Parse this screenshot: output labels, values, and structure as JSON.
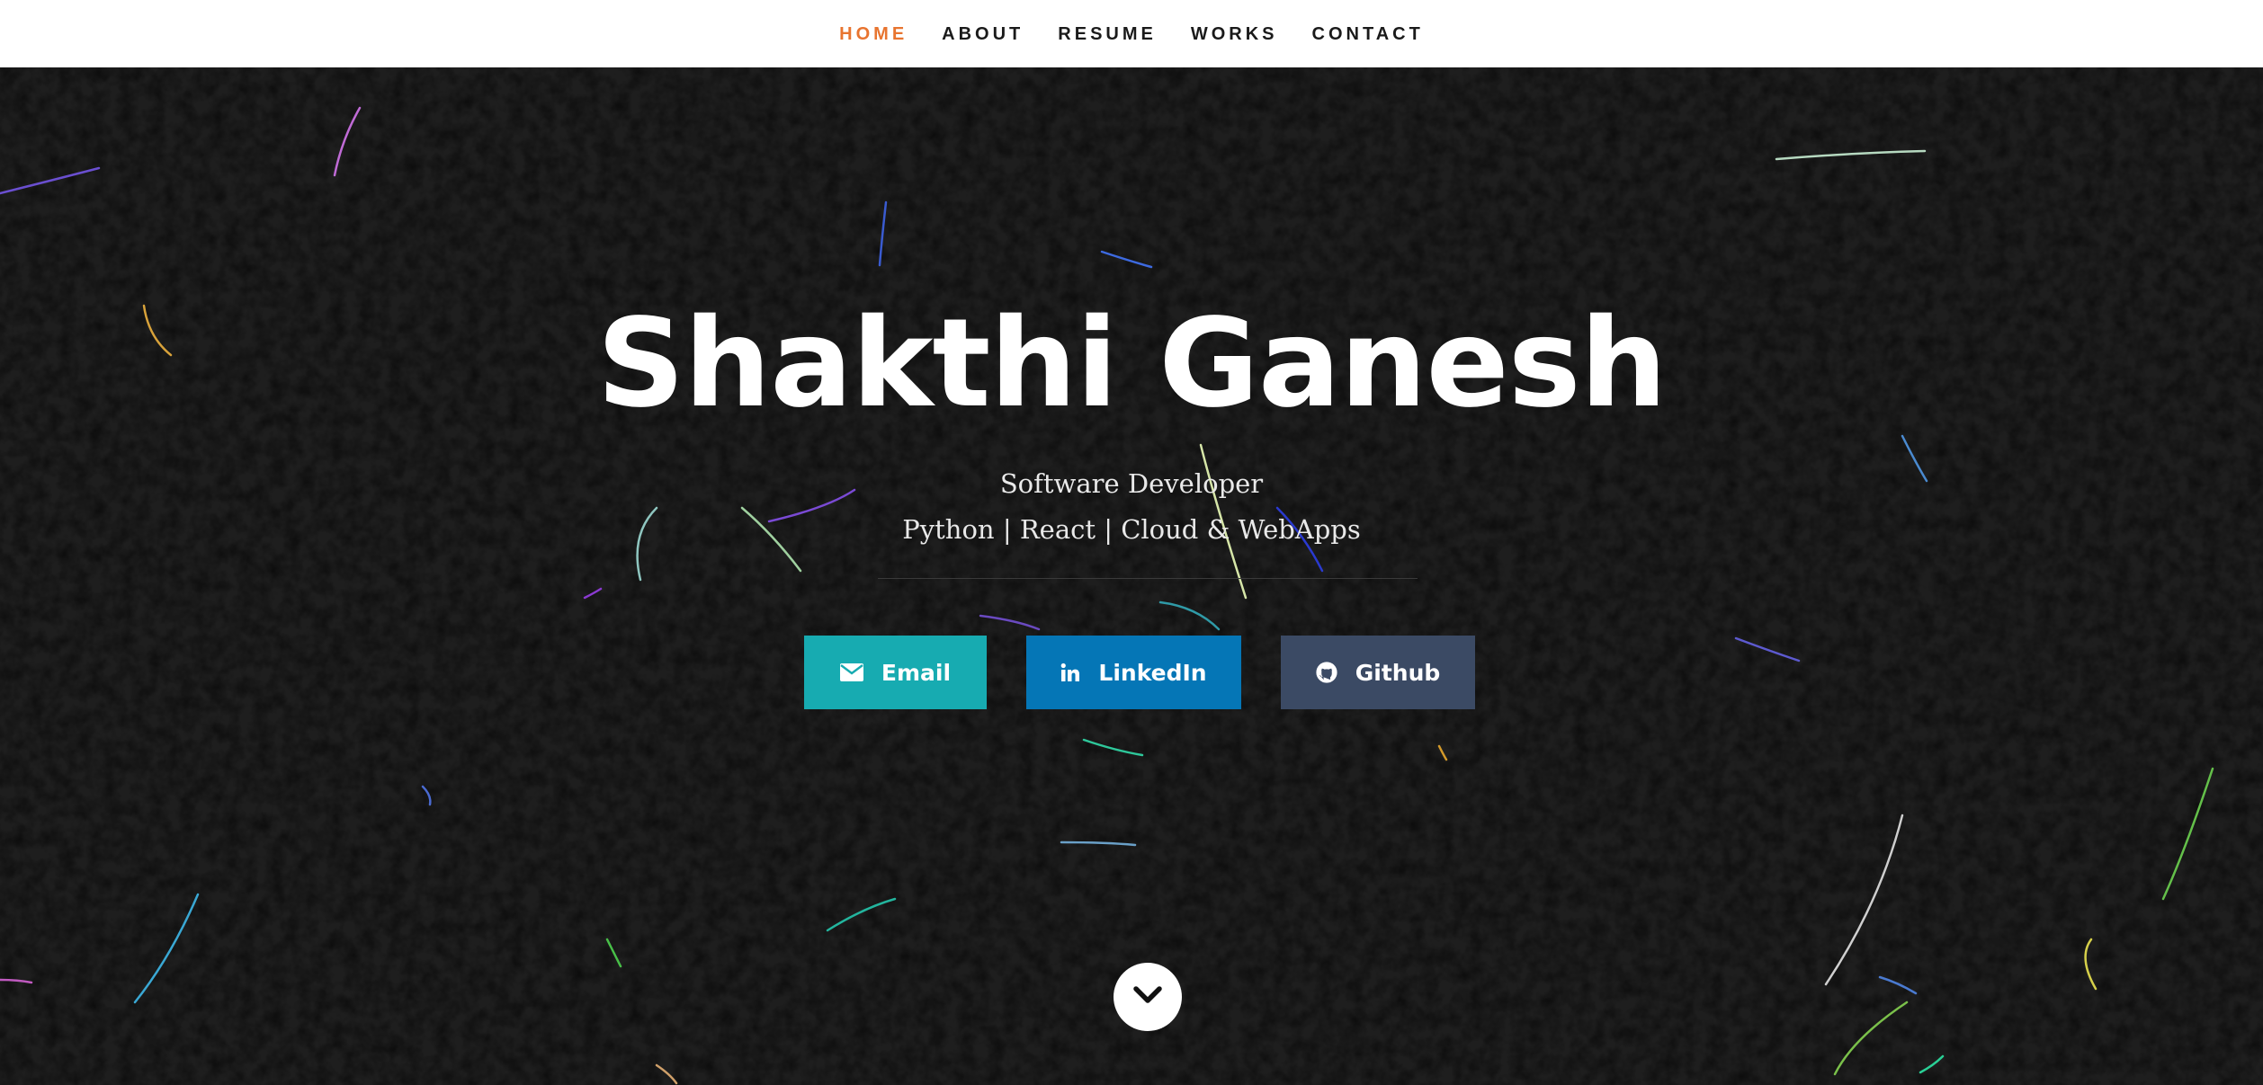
{
  "nav": {
    "items": [
      {
        "label": "HOME",
        "active": true
      },
      {
        "label": "ABOUT",
        "active": false
      },
      {
        "label": "RESUME",
        "active": false
      },
      {
        "label": "WORKS",
        "active": false
      },
      {
        "label": "CONTACT",
        "active": false
      }
    ],
    "active_color": "#e8742f"
  },
  "hero": {
    "title": "Shakthi Ganesh",
    "subtitle_line1": "Software Developer",
    "subtitle_line2": "Python | React | Cloud & WebApps",
    "background_color": "#1d1d1d"
  },
  "buttons": {
    "email": {
      "label": "Email",
      "icon": "envelope-icon",
      "color": "#17abb1"
    },
    "linkedin": {
      "label": "LinkedIn",
      "icon": "linkedin-icon",
      "color": "#0576b6"
    },
    "github": {
      "label": "Github",
      "icon": "github-icon",
      "color": "#3b4a64"
    }
  },
  "scroll_down": {
    "icon": "chevron-down-icon"
  }
}
